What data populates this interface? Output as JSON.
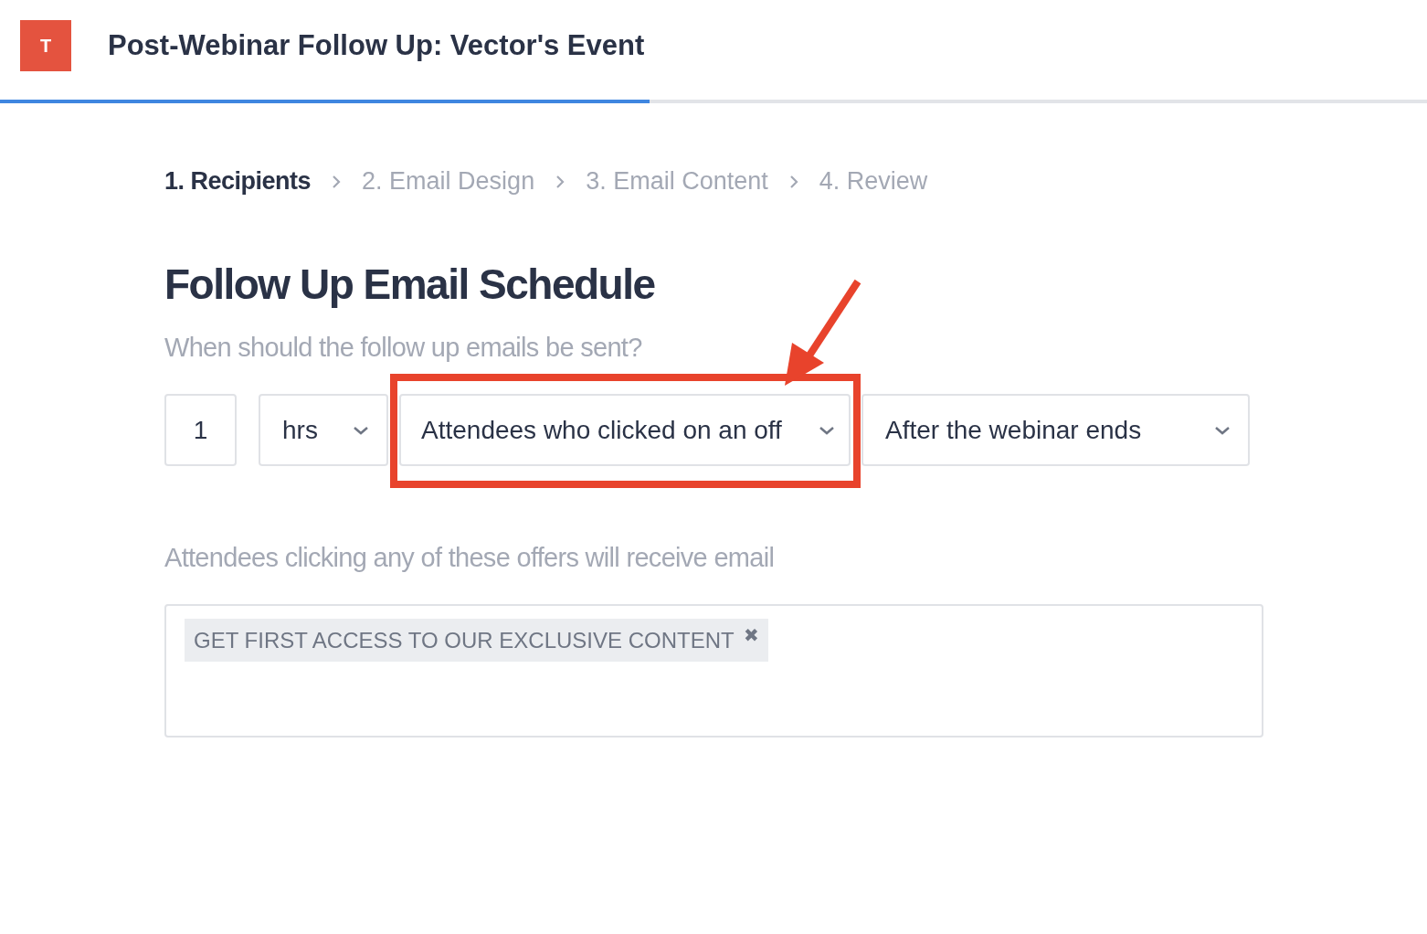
{
  "header": {
    "logo": "T",
    "title": "Post-Webinar Follow Up: Vector's Event"
  },
  "progress": {
    "level": 0.455
  },
  "steps": [
    {
      "label": "1. Recipients",
      "selected": true
    },
    {
      "label": "2. Email Design",
      "selected": false
    },
    {
      "label": "3. Email Content",
      "selected": false
    },
    {
      "label": "4. Review",
      "selected": false
    }
  ],
  "heading": "Follow Up Email Schedule",
  "question": "When should the follow up emails be sent?",
  "schedule": {
    "amount": "1",
    "unit": "hrs",
    "audience": "Attendees who clicked on an off",
    "timing": "After the webinar ends"
  },
  "offers_label": "Attendees clicking any of these offers will receive email",
  "offers": [
    {
      "label": "GET FIRST ACCESS TO OUR EXCLUSIVE CONTENT",
      "remove": "✖"
    }
  ]
}
